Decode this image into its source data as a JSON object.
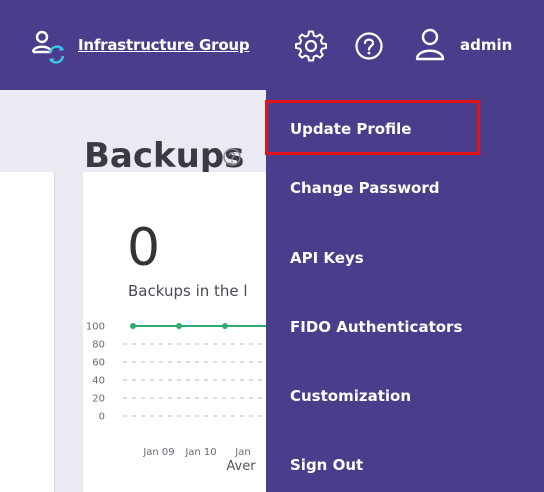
{
  "header": {
    "group_link": "Infrastructure Group",
    "user_name": "admin",
    "icons": [
      "group-icon",
      "gear-icon",
      "help-icon",
      "user-icon"
    ]
  },
  "page": {
    "title": "Backups"
  },
  "backups_card": {
    "count": "0",
    "label": "Backups in the l",
    "chart_data": {
      "type": "line",
      "x": [
        "Jan 09",
        "Jan 10",
        "Jan"
      ],
      "y_ticks": [
        "100",
        "80",
        "60",
        "40",
        "20",
        "0"
      ],
      "ylim": [
        0,
        100
      ],
      "grid": true,
      "series": [
        {
          "values": [
            100,
            100,
            100,
            100
          ],
          "color": "#2eaa6a"
        }
      ],
      "xlabel": "Aver"
    }
  },
  "user_menu": {
    "items": [
      {
        "label": "Update Profile",
        "highlighted": true
      },
      {
        "label": "Change Password"
      },
      {
        "label": "API Keys"
      },
      {
        "label": "FIDO Authenticators"
      },
      {
        "label": "Customization"
      },
      {
        "label": "Sign Out"
      }
    ]
  },
  "colors": {
    "header_bg": "#4a3d8c",
    "menu_bg": "#4a3d8c",
    "highlight": "#e0141b",
    "series": "#2eaa6a"
  }
}
